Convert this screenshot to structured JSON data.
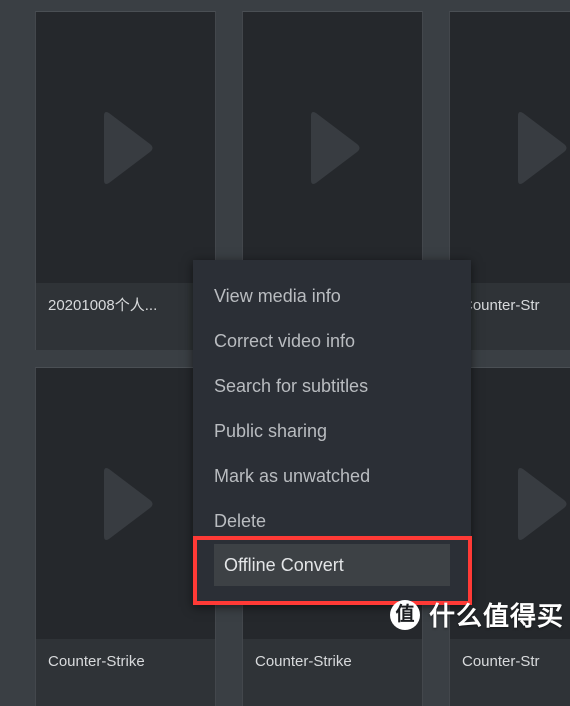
{
  "app": {
    "background_color": "#3a3f44",
    "card_color": "#25282c",
    "menu_background": "#2b2f36",
    "highlight_color": "#3d4145",
    "annotation_color": "#ff3a36",
    "text_color": "#b9bcc0"
  },
  "grid": {
    "items": [
      {
        "label": "20201008个人...",
        "icon": "play-icon"
      },
      {
        "label": "",
        "icon": "play-icon"
      },
      {
        "label": "Counter-Str",
        "icon": "play-icon"
      },
      {
        "label": "Counter-Strike",
        "icon": "play-icon"
      },
      {
        "label": "Counter-Strike",
        "icon": "play-icon"
      },
      {
        "label": "Counter-Str",
        "icon": "play-icon"
      }
    ]
  },
  "context_menu": {
    "items": [
      {
        "label": "View media info",
        "highlighted": false
      },
      {
        "label": "Correct video info",
        "highlighted": false
      },
      {
        "label": "Search for subtitles",
        "highlighted": false
      },
      {
        "label": "Public sharing",
        "highlighted": false
      },
      {
        "label": "Mark as unwatched",
        "highlighted": false
      },
      {
        "label": "Delete",
        "highlighted": false
      },
      {
        "label": "Offline Convert",
        "highlighted": true
      }
    ]
  },
  "watermark": {
    "badge": "值",
    "text": "什么值得买"
  }
}
